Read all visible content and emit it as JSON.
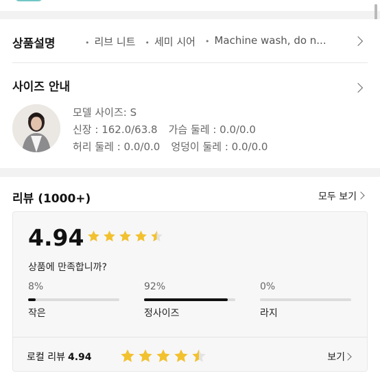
{
  "colors": {
    "star": "#f2c12e",
    "bar_fill": "#111111",
    "bar_track": "#dcdcdc"
  },
  "description": {
    "title": "상품설명",
    "tags": [
      "리브 니트",
      "세미 시어",
      "Machine wash, do n..."
    ]
  },
  "size_guide": {
    "title": "사이즈 안내",
    "model_size": "모델 사이즈: S",
    "height": "신장 : 162.0/63.8",
    "chest": "가슴 둘레 : 0.0/0.0",
    "waist": "허리 둘레 : 0.0/0.0",
    "hip": "엉덩이 둘레 : 0.0/0.0"
  },
  "reviews": {
    "title": "리뷰 (1000+)",
    "see_all": "모두 보기",
    "rating": "4.94",
    "rating_value": 4.94,
    "question": "상품에 만족합니까?",
    "options": [
      {
        "percent": "8%",
        "value": 0.08,
        "label": "작은"
      },
      {
        "percent": "92%",
        "value": 0.92,
        "label": "정사이즈"
      },
      {
        "percent": "0%",
        "value": 0.0,
        "label": "라지"
      }
    ],
    "local_label": "로컬 리뷰",
    "local_rating": "4.94",
    "local_see": "보기"
  }
}
